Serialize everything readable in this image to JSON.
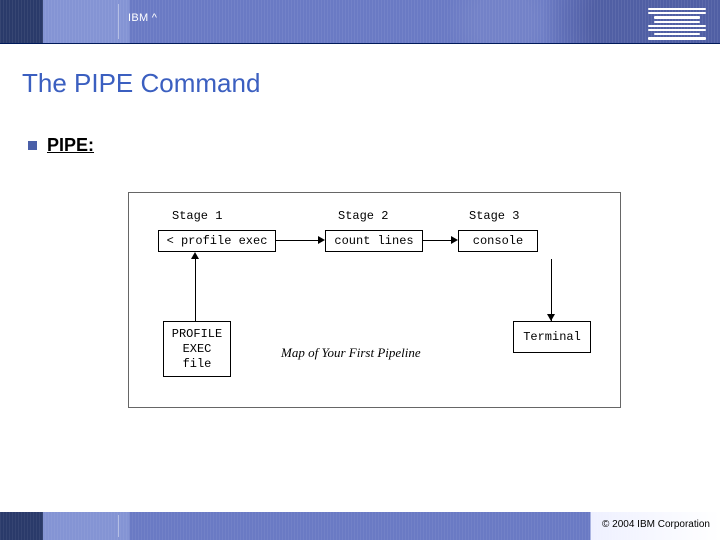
{
  "header": {
    "brand_text": "IBM ^"
  },
  "title": "The PIPE Command",
  "bullet": {
    "label": "PIPE:"
  },
  "diagram": {
    "stage_labels": {
      "s1": "Stage 1",
      "s2": "Stage 2",
      "s3": "Stage 3"
    },
    "boxes": {
      "stage1": "< profile exec",
      "stage2": "count lines",
      "stage3": "console",
      "file": "PROFILE\nEXEC\nfile",
      "terminal": "Terminal"
    },
    "caption": "Map of Your First Pipeline"
  },
  "footer": {
    "copyright": "© 2004 IBM Corporation"
  }
}
